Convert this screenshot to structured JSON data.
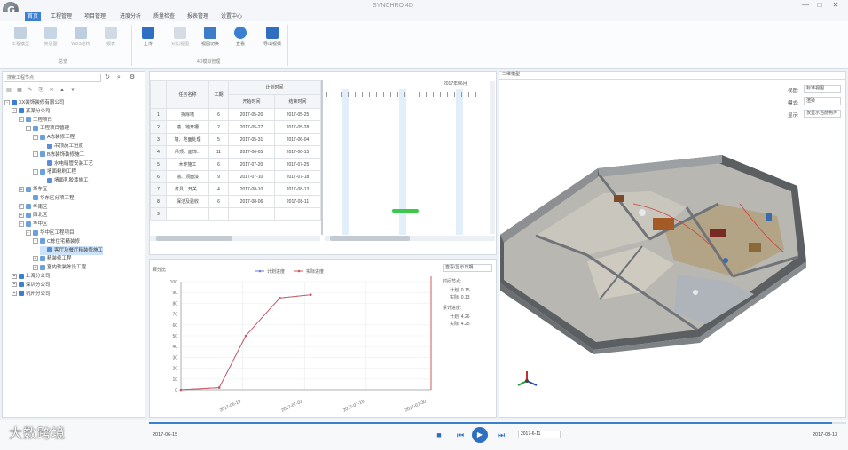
{
  "window": {
    "title": "SYNCHRO 4D"
  },
  "menu_tabs": [
    "首页",
    "工程管理",
    "项目管理",
    "进度分析",
    "质量检查",
    "报表管理",
    "设置中心"
  ],
  "ribbon": {
    "buttons": [
      {
        "label": "工程模型",
        "dim": true
      },
      {
        "label": "实景图",
        "dim": true
      },
      {
        "label": "WBS结构",
        "dim": true
      },
      {
        "label": "报表",
        "dim": true
      },
      {
        "label": "上传",
        "dim": false
      },
      {
        "label": "对比视图",
        "dim": true
      },
      {
        "label": "视图切换",
        "dim": false
      },
      {
        "label": "查看",
        "dim": false
      },
      {
        "label": "导出视频",
        "dim": false
      }
    ],
    "group_labels": [
      "总览",
      "4D模拟管理"
    ]
  },
  "left_panel": {
    "search_placeholder": "搜索工程节点",
    "tree": [
      {
        "level": 0,
        "label": "XX装饰装修有限公司",
        "toggle": "-",
        "sel": false
      },
      {
        "level": 1,
        "label": "某某分公司",
        "toggle": "-",
        "sel": false
      },
      {
        "level": 2,
        "label": "工程项目",
        "toggle": "-",
        "sel": false
      },
      {
        "level": 3,
        "label": "工程项目管理",
        "toggle": "-",
        "sel": false
      },
      {
        "level": 4,
        "label": "A栋装修工程",
        "toggle": "-",
        "sel": false
      },
      {
        "level": 5,
        "label": "吊顶施工进度",
        "toggle": "",
        "sel": false
      },
      {
        "level": 4,
        "label": "B栋装饰装修施工",
        "toggle": "-",
        "sel": false
      },
      {
        "level": 5,
        "label": "水电暗管安装工艺",
        "toggle": "",
        "sel": false
      },
      {
        "level": 4,
        "label": "墙面粉刷工程",
        "toggle": "-",
        "sel": false
      },
      {
        "level": 5,
        "label": "墙面乳胶漆施工",
        "toggle": "",
        "sel": false
      },
      {
        "level": 2,
        "label": "华东区",
        "toggle": "+",
        "sel": false
      },
      {
        "level": 3,
        "label": "华东区分项工程",
        "toggle": "",
        "sel": false
      },
      {
        "level": 2,
        "label": "华南区",
        "toggle": "+",
        "sel": false
      },
      {
        "level": 2,
        "label": "西北区",
        "toggle": "+",
        "sel": false
      },
      {
        "level": 2,
        "label": "华中区",
        "toggle": "-",
        "sel": false
      },
      {
        "level": 3,
        "label": "华中区工程项目",
        "toggle": "-",
        "sel": false
      },
      {
        "level": 4,
        "label": "C栋住宅精装修",
        "toggle": "-",
        "sel": false
      },
      {
        "level": 5,
        "label": "客厅及餐厅精装修施工",
        "toggle": "",
        "sel": true
      },
      {
        "level": 4,
        "label": "精装修工程",
        "toggle": "+",
        "sel": false
      },
      {
        "level": 4,
        "label": "室内软装陈设工程",
        "toggle": "+",
        "sel": false
      },
      {
        "level": 1,
        "label": "上海分公司",
        "toggle": "+",
        "sel": false
      },
      {
        "level": 1,
        "label": "深圳分公司",
        "toggle": "+",
        "sel": false
      },
      {
        "level": 1,
        "label": "杭州分公司",
        "toggle": "+",
        "sel": false
      }
    ]
  },
  "table": {
    "header_group": "计划时间",
    "headers": [
      "",
      "任务名称",
      "工期",
      "开始时间",
      "结束时间"
    ],
    "rows": [
      [
        "1",
        "拆除墙",
        "6",
        "2017-05-20",
        "2017-05-25"
      ],
      [
        "2",
        "墙、地开槽",
        "2",
        "2017-05-27",
        "2017-05-28"
      ],
      [
        "3",
        "墙、地面处理",
        "5",
        "2017-05-31",
        "2017-06-04"
      ],
      [
        "4",
        "吊顶、面饰...",
        "11",
        "2017-06-05",
        "2017-06-15"
      ],
      [
        "5",
        "木作施工",
        "6",
        "2017-07-20",
        "2017-07-25"
      ],
      [
        "6",
        "墙、顶面漆",
        "9",
        "2017-07-10",
        "2017-07-18"
      ],
      [
        "7",
        "灯具、开关...",
        "4",
        "2017-08-10",
        "2017-08-13"
      ],
      [
        "8",
        "保洁及验收",
        "6",
        "2017-08-06",
        "2017-08-11"
      ],
      [
        "9",
        "",
        "",
        "",
        ""
      ]
    ],
    "gantt_title": "2017年06月"
  },
  "chart_data": {
    "type": "line",
    "title": "",
    "y_label": "百分比",
    "x": [
      "2017-06-18",
      "2017-07-02",
      "2017-07-16",
      "2017-07-30"
    ],
    "ylim": [
      0,
      100
    ],
    "y_ticks": [
      "0",
      "10",
      "20",
      "30",
      "40",
      "50",
      "60",
      "70",
      "80",
      "90",
      "100"
    ],
    "legend_position": "top-center",
    "series": [
      {
        "name": "计划进度",
        "color": "#6a7fd8",
        "points": [
          [
            0,
            0
          ],
          [
            0.62,
            2
          ],
          [
            1.05,
            50
          ],
          [
            1.6,
            85
          ],
          [
            2.1,
            88
          ]
        ]
      },
      {
        "name": "实际进度",
        "color": "#d05a5a",
        "points": [
          [
            0,
            0
          ],
          [
            0.62,
            2
          ],
          [
            1.05,
            50
          ],
          [
            1.6,
            85
          ],
          [
            2.1,
            88
          ]
        ]
      }
    ]
  },
  "chart_side": {
    "select_value": "查看/显示日期",
    "plan_label": "时间节点:",
    "plan_values": [
      "计划: 0.15",
      "实际: 0.13"
    ],
    "actual_label": "累计进度:",
    "actual_values": [
      "计划: 4.26",
      "实际: 4.25"
    ]
  },
  "view3d": {
    "tab_label": "三维模型",
    "controls": [
      {
        "label": "视图:",
        "value": "标准视图"
      },
      {
        "label": "模式:",
        "value": "渲染"
      },
      {
        "label": "显示:",
        "value": "仅显示当前构件"
      }
    ]
  },
  "timeline": {
    "start_date": "2017-06-15",
    "end_date": "2017-08-13",
    "progress": 0.98,
    "speed_value": "2017-6-11"
  },
  "watermark": "大数跨境",
  "colors": {
    "accent": "#3a7fd0",
    "gantt_bar": "#3cc84f"
  }
}
